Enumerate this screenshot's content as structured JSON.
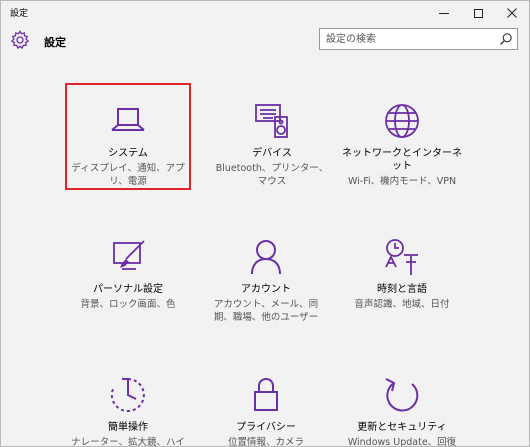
{
  "window": {
    "title": "設定",
    "accent_color": "#6b2fa6",
    "selection_color": "#e0252a"
  },
  "header": {
    "title": "設定",
    "icon": "gear-icon"
  },
  "search": {
    "placeholder": "設定の検索",
    "icon": "search-icon"
  },
  "tiles": [
    {
      "id": "system",
      "label": "システム",
      "desc": "ディスプレイ、通知、アプリ、電源",
      "icon": "laptop-icon",
      "selected": true
    },
    {
      "id": "devices",
      "label": "デバイス",
      "desc": "Bluetooth、プリンター、マウス",
      "icon": "devices-icon",
      "selected": false
    },
    {
      "id": "network",
      "label": "ネットワークとインターネット",
      "desc": "Wi-Fi、機内モード、VPN",
      "icon": "globe-icon",
      "selected": false
    },
    {
      "id": "personalization",
      "label": "パーソナル設定",
      "desc": "背景、ロック画面、色",
      "icon": "paint-icon",
      "selected": false
    },
    {
      "id": "accounts",
      "label": "アカウント",
      "desc": "アカウント、メール、同期、職場、他のユーザー",
      "icon": "person-icon",
      "selected": false
    },
    {
      "id": "time",
      "label": "時刻と言語",
      "desc": "音声認識、地域、日付",
      "icon": "time-language-icon",
      "selected": false
    },
    {
      "id": "ease",
      "label": "簡単操作",
      "desc": "ナレーター、拡大鏡、ハイ",
      "icon": "ease-of-access-icon",
      "selected": false
    },
    {
      "id": "privacy",
      "label": "プライバシー",
      "desc": "位置情報、カメラ",
      "icon": "lock-icon",
      "selected": false
    },
    {
      "id": "update",
      "label": "更新とセキュリティ",
      "desc": "Windows Update、回復",
      "icon": "refresh-icon",
      "selected": false
    }
  ]
}
